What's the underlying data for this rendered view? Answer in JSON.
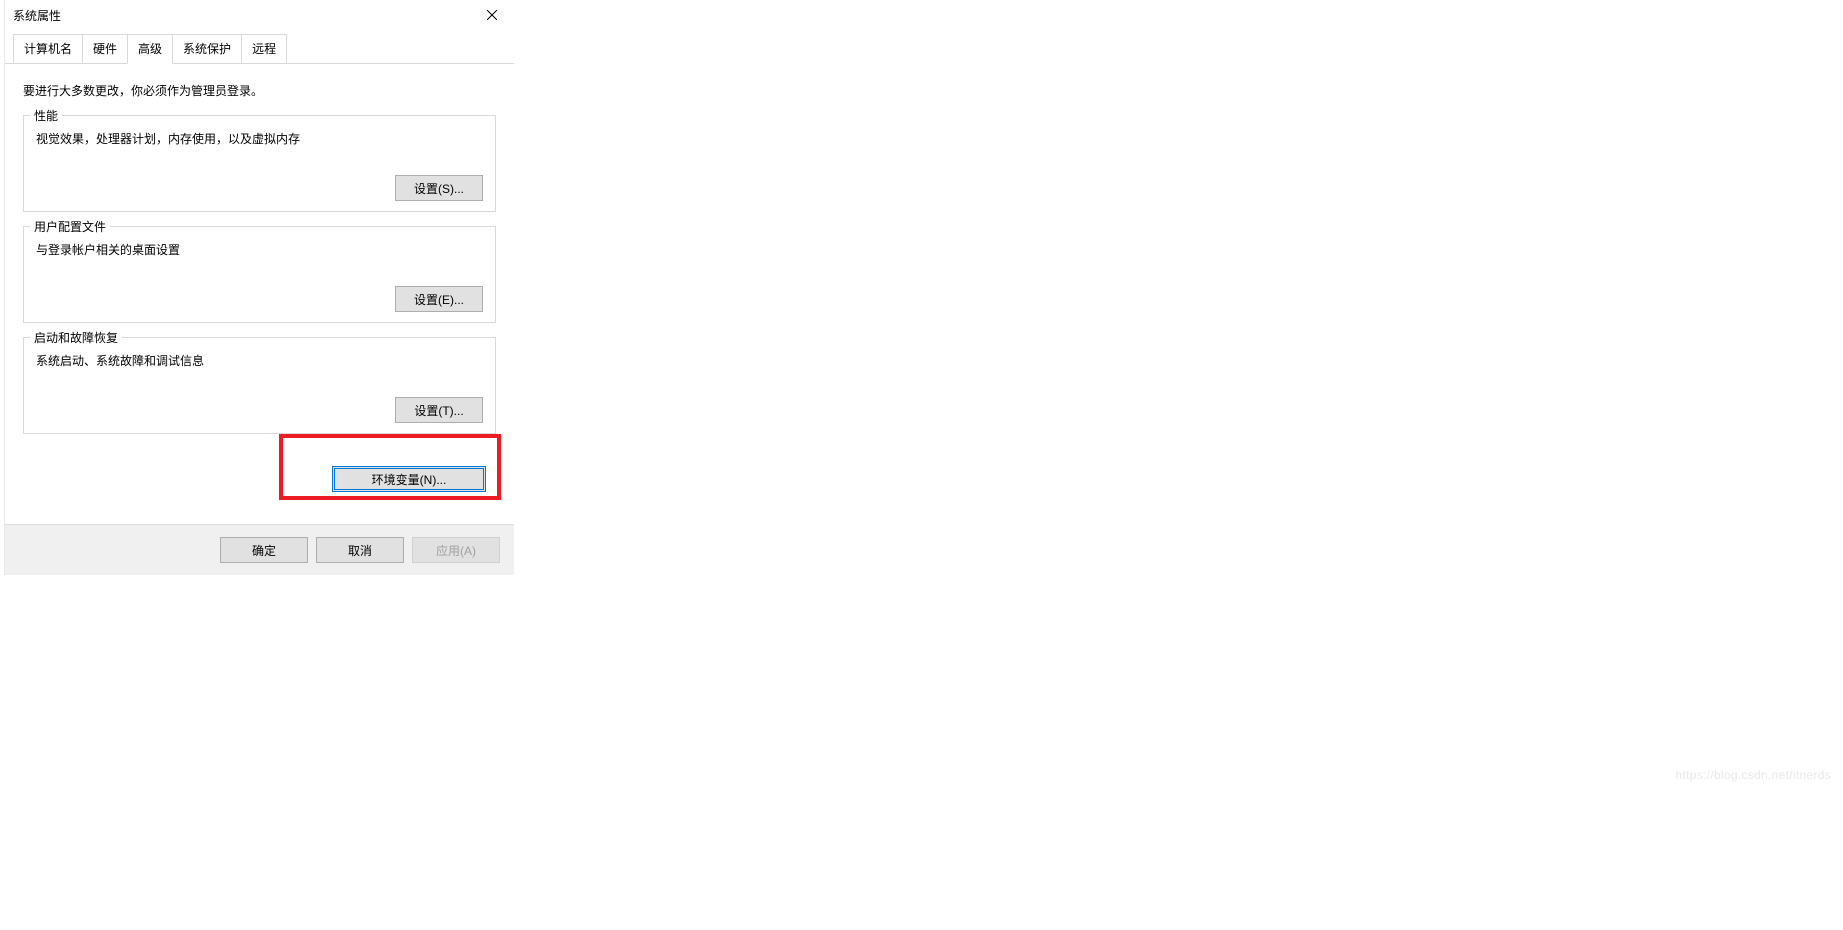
{
  "dialog": {
    "title": "系统属性",
    "tabs": {
      "computer_name": "计算机名",
      "hardware": "硬件",
      "advanced": "高级",
      "system_protection": "系统保护",
      "remote": "远程"
    },
    "intro": "要进行大多数更改，你必须作为管理员登录。",
    "performance": {
      "legend": "性能",
      "text": "视觉效果，处理器计划，内存使用，以及虚拟内存",
      "button": "设置(S)..."
    },
    "user_profiles": {
      "legend": "用户配置文件",
      "text": "与登录帐户相关的桌面设置",
      "button": "设置(E)..."
    },
    "startup_recovery": {
      "legend": "启动和故障恢复",
      "text": "系统启动、系统故障和调试信息",
      "button": "设置(T)..."
    },
    "env_button": "环境变量(N)...",
    "ok": "确定",
    "cancel": "取消",
    "apply": "应用(A)"
  },
  "watermark": "https://blog.csdn.net/itnerds"
}
